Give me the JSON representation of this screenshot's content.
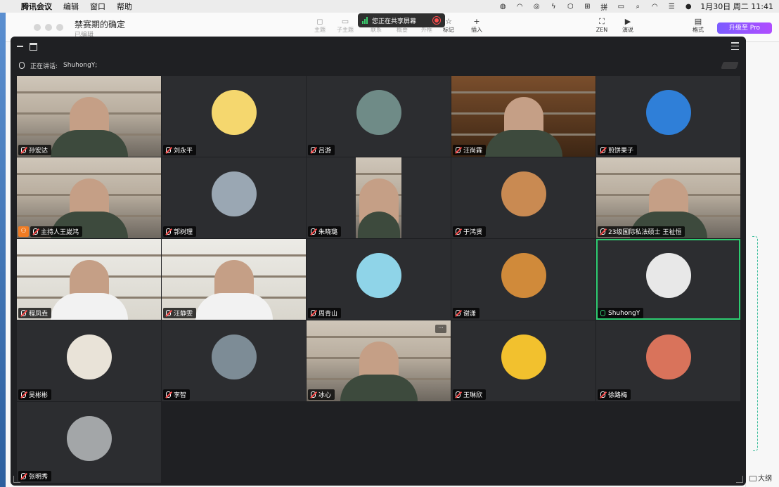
{
  "menubar": {
    "app_name": "腾讯会议",
    "items": [
      "编辑",
      "窗口",
      "帮助"
    ],
    "clock": "1月30日 周二  11:41"
  },
  "document": {
    "title": "禁赛期的确定",
    "subtitle": "已编辑",
    "toolbar": [
      {
        "label": "主题",
        "glyph": "◻"
      },
      {
        "label": "子主题",
        "glyph": "▭"
      },
      {
        "label": "联系",
        "glyph": "⇄"
      },
      {
        "label": "概要",
        "glyph": "}"
      },
      {
        "label": "外框",
        "glyph": "▢"
      },
      {
        "label": "标记",
        "glyph": "☆"
      },
      {
        "label": "插入",
        "glyph": "+"
      },
      {
        "label": "ZEN",
        "glyph": "⛶"
      },
      {
        "label": "演说",
        "glyph": "▶"
      },
      {
        "label": "格式",
        "glyph": "▤"
      }
    ],
    "upgrade_label": "升级至 Pro",
    "outline_label": "大纲"
  },
  "share_banner": {
    "text": "您正在共享屏幕"
  },
  "meeting": {
    "speaking_prefix": "正在讲话:",
    "speaking_name": "ShuhongY;"
  },
  "participants": [
    {
      "name": "孙宏达",
      "tile": "video",
      "mic": "muted"
    },
    {
      "name": "刘永平",
      "tile": "avatar",
      "mic": "muted",
      "avatar_color": "#f5d76e"
    },
    {
      "name": "吕游",
      "tile": "avatar",
      "mic": "muted",
      "avatar_color": "#6f8b87"
    },
    {
      "name": "汪尚霖",
      "tile": "video-books",
      "mic": "muted"
    },
    {
      "name": "煎饼果子",
      "tile": "avatar",
      "mic": "muted",
      "avatar_color": "#2f7fd8"
    },
    {
      "name": "主持人王嵗鸿",
      "tile": "video",
      "mic": "muted",
      "host": true
    },
    {
      "name": "郭树理",
      "tile": "avatar",
      "mic": "muted",
      "avatar_color": "#9aa7b3"
    },
    {
      "name": "朱晓璐",
      "tile": "video-narrow",
      "mic": "muted"
    },
    {
      "name": "于鸿贤",
      "tile": "avatar",
      "mic": "muted",
      "avatar_color": "#c98a52"
    },
    {
      "name": "23级国际私法硕士 王祉恒",
      "tile": "video",
      "mic": "muted"
    },
    {
      "name": "程凤垚",
      "tile": "video-white",
      "mic": "muted"
    },
    {
      "name": "汪静雯",
      "tile": "video-white",
      "mic": "muted"
    },
    {
      "name": "周青山",
      "tile": "avatar",
      "mic": "muted",
      "avatar_color": "#8fd4e8"
    },
    {
      "name": "谢潇",
      "tile": "avatar",
      "mic": "muted",
      "avatar_color": "#d08a3a"
    },
    {
      "name": "ShuhongY",
      "tile": "avatar",
      "mic": "on",
      "avatar_color": "#e8e8e8",
      "active": true
    },
    {
      "name": "吴彬彬",
      "tile": "avatar",
      "mic": "muted",
      "avatar_color": "#e9e3d8"
    },
    {
      "name": "李智",
      "tile": "avatar",
      "mic": "muted",
      "avatar_color": "#7d8c96"
    },
    {
      "name": "冰心",
      "tile": "video",
      "mic": "muted",
      "more": "···"
    },
    {
      "name": "王琳欣",
      "tile": "avatar",
      "mic": "muted",
      "avatar_color": "#f2c12e"
    },
    {
      "name": "徐路梅",
      "tile": "avatar",
      "mic": "muted",
      "avatar_color": "#d9735b"
    },
    {
      "name": "张明秀",
      "tile": "avatar",
      "mic": "muted",
      "avatar_color": "#a3a6a8"
    }
  ],
  "colors": {
    "meeting_bg": "#1f2023",
    "tile_bg": "#2c2d30",
    "active_border": "#2ecc71",
    "muted_red": "#ff4d4d",
    "host_orange": "#f07c24",
    "upgrade_purple": "#7b5cff"
  }
}
